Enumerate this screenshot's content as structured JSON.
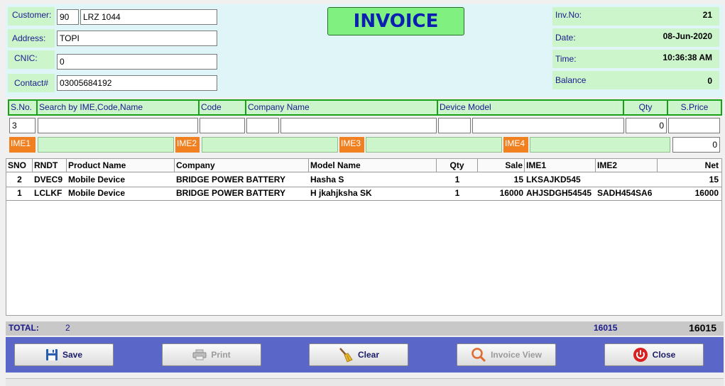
{
  "header": {
    "title": "INVOICE",
    "customer_label": "Customer:",
    "customer_id": "90",
    "customer_name": "LRZ 1044",
    "address_label": "Address:",
    "address": "TOPI",
    "cnic_label": "CNIC:",
    "cnic": "0",
    "contact_label": "Contact#",
    "contact": "03005684192",
    "inv_no_label": "Inv.No:",
    "inv_no": "21",
    "date_label": "Date:",
    "date": "08-Jun-2020",
    "time_label": "Time:",
    "time": "10:36:38 AM",
    "balance_label": "Balance",
    "balance": "0"
  },
  "search": {
    "headers": {
      "sno": "S.No.",
      "search": "Search by IME,Code,Name",
      "code": "Code",
      "company": "Company Name",
      "device_model": "Device Model",
      "qty": "Qty",
      "sprice": "S.Price"
    },
    "sno_value": "3",
    "qty_value": "0",
    "ime_labels": [
      "IME1",
      "IME2",
      "IME3",
      "IME4"
    ],
    "ime_total": "0"
  },
  "grid": {
    "columns": [
      "SNO",
      "RNDT",
      "Product Name",
      "Company",
      "Model Name",
      "Qty",
      "Sale",
      "IME1",
      "IME2",
      "Net"
    ],
    "rows": [
      {
        "sno": "2",
        "rndt": "DVEC9",
        "product": "Mobile Device",
        "company": "BRIDGE POWER BATTERY",
        "model": "Hasha S",
        "qty": "1",
        "sale": "15",
        "ime1": "LKSAJKD545",
        "ime2": "",
        "net": "15"
      },
      {
        "sno": "1",
        "rndt": "LCLKF",
        "product": "Mobile Device",
        "company": "BRIDGE POWER BATTERY",
        "model": "H jkahjksha SK",
        "qty": "1",
        "sale": "16000",
        "ime1": "AHJSDGH54545",
        "ime2": "SADH454SA6",
        "net": "16000"
      }
    ]
  },
  "totals": {
    "label": "TOTAL:",
    "count": "2",
    "sale_total": "16015",
    "net_total": "16015"
  },
  "footer": {
    "save": "Save",
    "print": "Print",
    "clear": "Clear",
    "invoice_view": "Invoice View",
    "close": "Close"
  }
}
